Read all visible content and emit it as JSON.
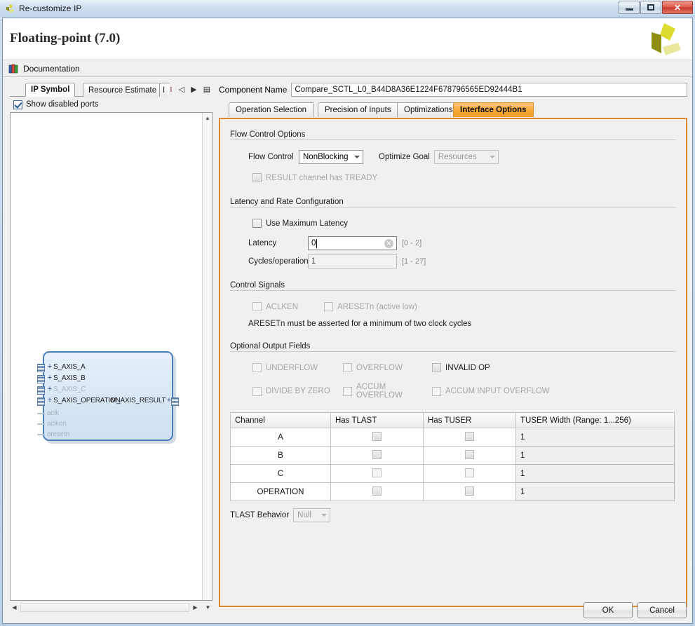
{
  "window": {
    "title": "Re-customize IP",
    "icon": "xilinx-logo-icon",
    "minimize_label": "",
    "maximize_label": "",
    "close_label": "✕"
  },
  "header": {
    "ip_title": "Floating-point (7.0)",
    "logo": "xilinx-pinwheel-logo"
  },
  "documentation": {
    "label": "Documentation",
    "icon": "books-icon"
  },
  "left_panel": {
    "tabs": [
      {
        "label": "IP Symbol",
        "active": true
      },
      {
        "label": "Resource Estimate",
        "active": false
      },
      {
        "label": "I",
        "active": false
      }
    ],
    "nav": {
      "text_icon": "I",
      "prev_icon": "◁",
      "next_icon": "▶",
      "menu_icon": "▤"
    },
    "show_disabled_ports": {
      "label": "Show disabled ports",
      "checked": true
    },
    "symbol": {
      "ports_left": [
        {
          "name": "S_AXIS_A",
          "enabled": true
        },
        {
          "name": "S_AXIS_B",
          "enabled": true
        },
        {
          "name": "S_AXIS_C",
          "enabled": false
        },
        {
          "name": "S_AXIS_OPERATION",
          "enabled": true
        }
      ],
      "clocks_left": [
        {
          "name": "aclk",
          "enabled": false
        },
        {
          "name": "aclken",
          "enabled": false
        },
        {
          "name": "aresetn",
          "enabled": false
        }
      ],
      "ports_right": [
        {
          "name": "M_AXIS_RESULT",
          "enabled": true
        }
      ]
    },
    "scroll": {
      "up_arrow": "▲",
      "down_arrow": "▼",
      "left_arrow": "◀",
      "right_arrow": "▶"
    }
  },
  "right_panel": {
    "component_name": {
      "label": "Component Name",
      "value": "Compare_SCTL_L0_B44D8A36E1224F678796565ED92444B1"
    },
    "tabs": [
      {
        "label": "Operation Selection",
        "active": false
      },
      {
        "label": "Precision of Inputs",
        "active": false
      },
      {
        "label": "Optimizations",
        "active": false
      },
      {
        "label": "Interface Options",
        "active": true
      }
    ],
    "sections": {
      "flow_control": {
        "title": "Flow Control Options",
        "flow_control_label": "Flow Control",
        "flow_control_value": "NonBlocking",
        "optimize_goal_label": "Optimize Goal",
        "optimize_goal_value": "Resources",
        "result_tready": {
          "label": "RESULT channel has TREADY",
          "checked": false,
          "enabled": false
        }
      },
      "latency": {
        "title": "Latency and Rate Configuration",
        "use_max_latency": {
          "label": "Use Maximum Latency",
          "checked": false,
          "enabled": true
        },
        "latency_label": "Latency",
        "latency_value": "0",
        "latency_range": "[0 - 2]",
        "latency_clear_icon": "✕",
        "cycles_label": "Cycles/operation",
        "cycles_value": "1",
        "cycles_range": "[1 - 27]"
      },
      "control_signals": {
        "title": "Control Signals",
        "aclken": {
          "label": "ACLKEN",
          "checked": false,
          "enabled": false
        },
        "aresetn": {
          "label": "ARESETn (active low)",
          "checked": false,
          "enabled": false
        },
        "note": "ARESETn must be asserted for a minimum of two clock cycles"
      },
      "optional_outputs": {
        "title": "Optional Output Fields",
        "items": [
          {
            "label": "UNDERFLOW",
            "checked": false,
            "enabled": false
          },
          {
            "label": "OVERFLOW",
            "checked": false,
            "enabled": false
          },
          {
            "label": "INVALID OP",
            "checked": false,
            "enabled": true
          },
          {
            "label": "DIVIDE BY ZERO",
            "checked": false,
            "enabled": false
          },
          {
            "label": "ACCUM OVERFLOW",
            "checked": false,
            "enabled": false
          },
          {
            "label": "ACCUM INPUT OVERFLOW",
            "checked": false,
            "enabled": false
          }
        ]
      },
      "channel_table": {
        "headers": [
          "Channel",
          "Has TLAST",
          "Has TUSER",
          "TUSER Width (Range: 1...256)"
        ],
        "rows": [
          {
            "channel": "A",
            "has_tlast": false,
            "has_tuser": false,
            "tuser_width": "1"
          },
          {
            "channel": "B",
            "has_tlast": false,
            "has_tuser": false,
            "tuser_width": "1"
          },
          {
            "channel": "C",
            "has_tlast": false,
            "has_tuser": false,
            "tuser_width": "1"
          },
          {
            "channel": "OPERATION",
            "has_tlast": false,
            "has_tuser": false,
            "tuser_width": "1"
          }
        ]
      },
      "tlast_behavior": {
        "label": "TLAST Behavior",
        "value": "Null"
      }
    }
  },
  "buttons": {
    "ok": "OK",
    "cancel": "Cancel"
  }
}
